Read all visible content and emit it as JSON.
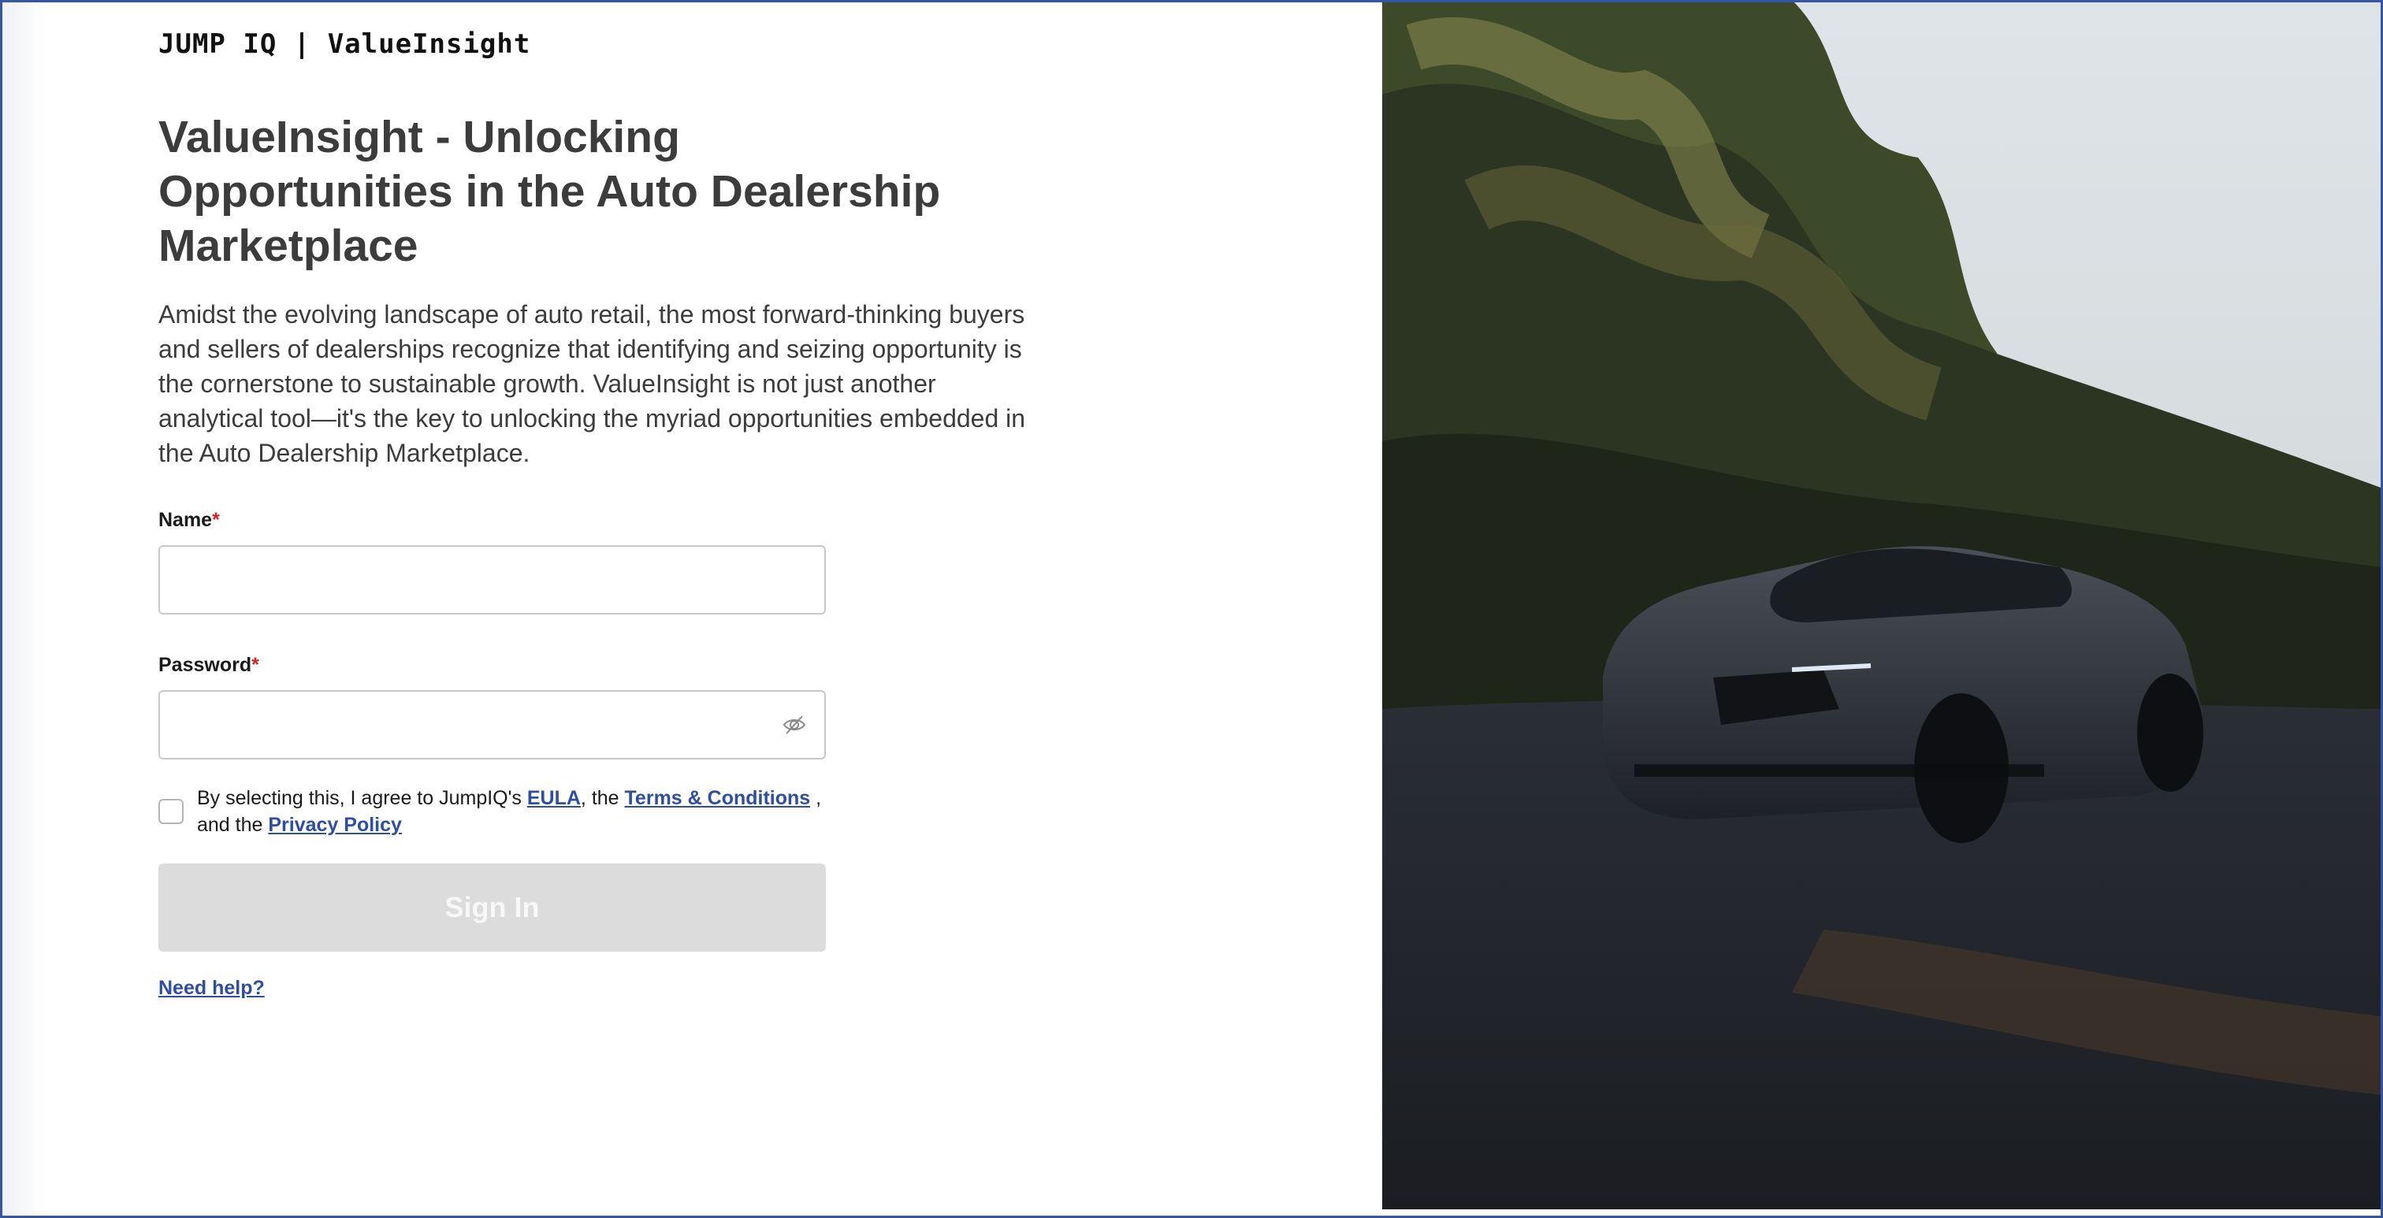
{
  "brand": {
    "logo_text": "JUMP IQ | ValueInsight"
  },
  "hero": {
    "headline": "ValueInsight - Unlocking Opportunities in the Auto Dealership Marketplace",
    "description": "Amidst the evolving landscape of auto retail, the most forward-thinking buyers and sellers of dealerships recognize that identifying and seizing opportunity is the cornerstone to sustainable growth. ValueInsight is not just another analytical tool—it's the key to unlocking the myriad opportunities embedded in the Auto Dealership Marketplace."
  },
  "form": {
    "name_label": "Name",
    "name_value": "",
    "password_label": "Password",
    "password_value": "",
    "required_mark": "*",
    "password_toggle_icon": "eye-off-icon",
    "consent": {
      "checked": false,
      "prefix": "By selecting this, I agree to JumpIQ's ",
      "eula_link": "EULA",
      "mid1": ", the ",
      "terms_link": "Terms & Conditions",
      "mid2": " , and the ",
      "privacy_link": "Privacy Policy"
    },
    "signin_label": "Sign In",
    "help_link": "Need help?"
  },
  "image": {
    "subject": "car-photo"
  },
  "colors": {
    "link": "#2f4f9e",
    "required": "#d32020",
    "button_disabled_bg": "#dcdcdc",
    "heading": "#3c3c3c",
    "frame": "#3455a8"
  }
}
